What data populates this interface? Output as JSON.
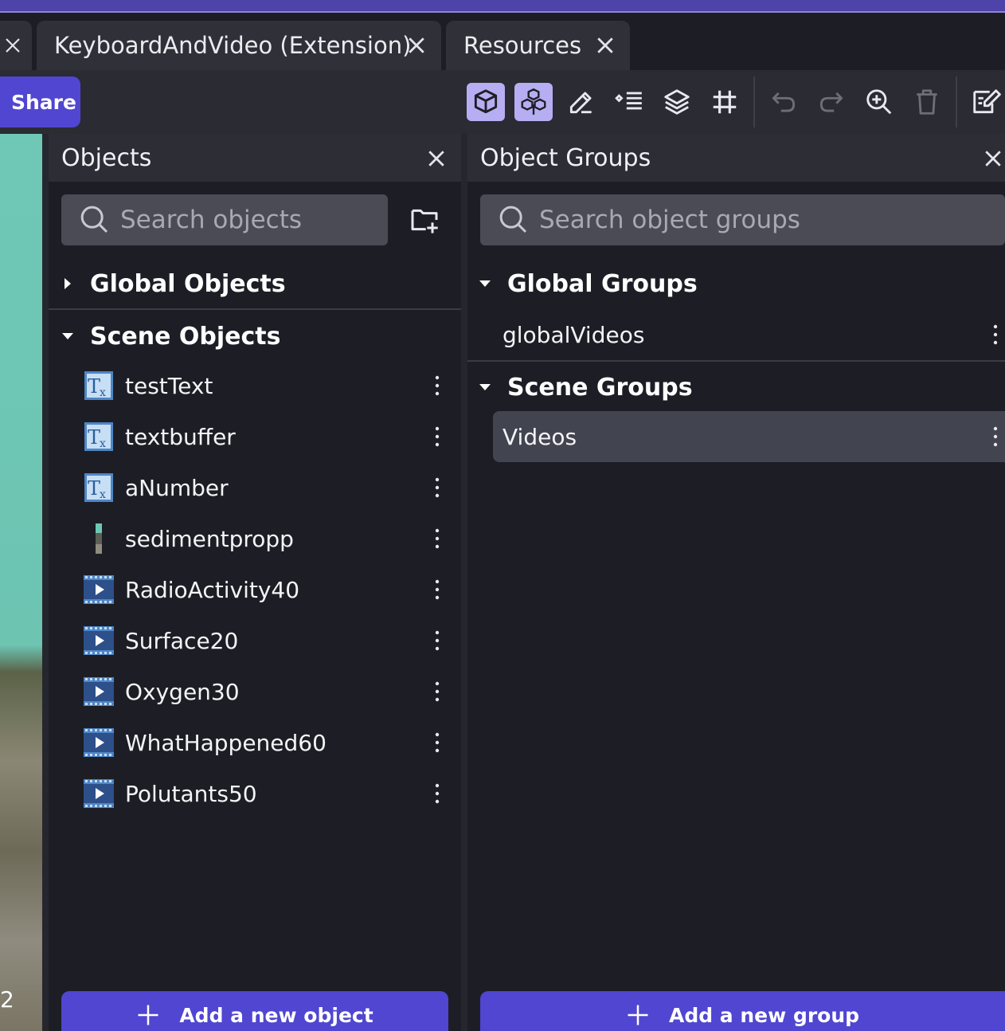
{
  "tabs": [
    {
      "label": "KeyboardAndVideo (Extension)"
    },
    {
      "label": "Resources"
    }
  ],
  "toolbar": {
    "share_label": "Share",
    "tools": [
      "object-icon",
      "objects-group-icon",
      "edit-icon",
      "list-icon",
      "layers-icon",
      "grid-icon",
      "undo-icon",
      "redo-icon",
      "zoom-icon",
      "trash-icon",
      "edit-events-icon"
    ]
  },
  "viewport": {
    "badge": "2"
  },
  "objects_panel": {
    "title": "Objects",
    "search_placeholder": "Search objects",
    "global_section": "Global Objects",
    "scene_section": "Scene Objects",
    "items": [
      {
        "name": "testText",
        "icon": "text-object-icon"
      },
      {
        "name": "textbuffer",
        "icon": "text-object-icon"
      },
      {
        "name": "aNumber",
        "icon": "text-object-icon"
      },
      {
        "name": "sedimentpropp",
        "icon": "sprite-object-icon"
      },
      {
        "name": "RadioActivity40",
        "icon": "video-object-icon"
      },
      {
        "name": "Surface20",
        "icon": "video-object-icon"
      },
      {
        "name": "Oxygen30",
        "icon": "video-object-icon"
      },
      {
        "name": "WhatHappened60",
        "icon": "video-object-icon"
      },
      {
        "name": "Polutants50",
        "icon": "video-object-icon"
      }
    ],
    "add_label": "Add a new object"
  },
  "groups_panel": {
    "title": "Object Groups",
    "search_placeholder": "Search object groups",
    "global_section": "Global Groups",
    "global_items": [
      {
        "name": "globalVideos"
      }
    ],
    "scene_section": "Scene Groups",
    "scene_items": [
      {
        "name": "Videos"
      }
    ],
    "add_label": "Add a new group"
  },
  "colors": {
    "accent": "#5046d1",
    "active_tool": "#b6aef2",
    "panel_bg": "#1d1e25",
    "selected_row": "#424550"
  }
}
